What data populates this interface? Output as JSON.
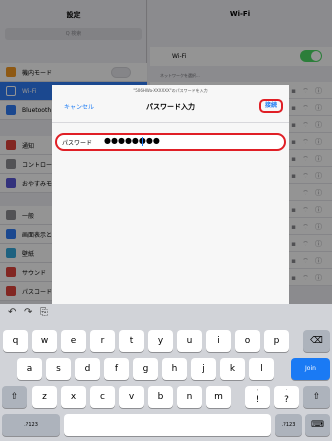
{
  "settings": {
    "title": "設定",
    "search_placeholder": "Q 検索",
    "items": [
      {
        "label": "機内モード",
        "color": "#f59a23"
      },
      {
        "label": "Wi-Fi",
        "color": "#2f7cf6"
      },
      {
        "label": "Bluetooth",
        "color": "#2f7cf6"
      },
      {
        "label": "通知",
        "color": "#e0443b"
      },
      {
        "label": "コントロールセンター",
        "color": "#8e8e93"
      },
      {
        "label": "おやすみモード",
        "color": "#5856d6"
      },
      {
        "label": "一般",
        "color": "#8e8e93"
      },
      {
        "label": "画面表示と明るさ",
        "color": "#2f7cf6"
      },
      {
        "label": "壁紙",
        "color": "#34aadc"
      },
      {
        "label": "サウンド",
        "color": "#e0443b"
      },
      {
        "label": "パスコード",
        "color": "#e0443b"
      }
    ]
  },
  "wifi": {
    "title": "Wi-Fi",
    "toggle_label": "Wi-Fi",
    "networks_header": "ネットワークを選択...",
    "toggle_on": true
  },
  "modal": {
    "subtitle": "\"506HWa-XXXXXX\"のパスワードを入力",
    "cancel": "キャンセル",
    "title": "パスワード入力",
    "join": "接続",
    "password_label": "パスワード",
    "password_value": "●●●●●●●●"
  },
  "keyboard": {
    "toolbar": [
      "undo-icon",
      "redo-icon",
      "paste-icon"
    ],
    "row1": [
      "q",
      "w",
      "e",
      "r",
      "t",
      "y",
      "u",
      "i",
      "o",
      "p"
    ],
    "row2": [
      "a",
      "s",
      "d",
      "f",
      "g",
      "h",
      "j",
      "k",
      "l"
    ],
    "row3": [
      "z",
      "x",
      "c",
      "v",
      "b",
      "n",
      "m"
    ],
    "row3_hint1": {
      "main": "!",
      "sup": ","
    },
    "row3_hint2": {
      "main": "?",
      "sup": "."
    },
    "join_key": "Join",
    "mode_key": ".?123",
    "mode_key_right": ".?123"
  }
}
